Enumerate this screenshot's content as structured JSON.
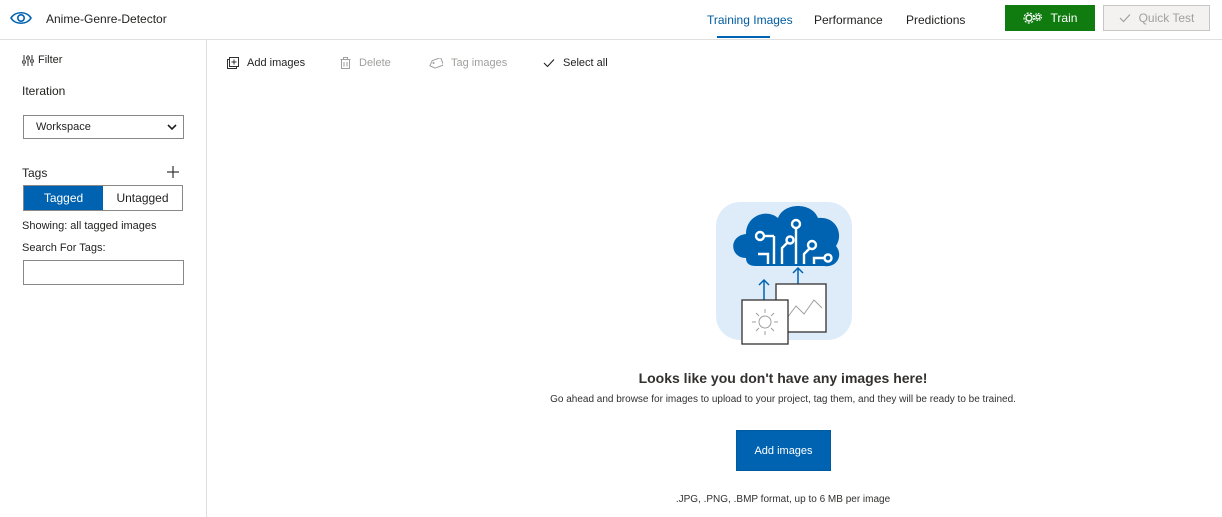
{
  "app": {
    "title": "Anime-Genre-Detector",
    "logo_icon": "eye-icon"
  },
  "nav": {
    "tabs": [
      {
        "label": "Training Images",
        "active": true
      },
      {
        "label": "Performance",
        "active": false
      },
      {
        "label": "Predictions",
        "active": false
      }
    ],
    "train_label": "Train",
    "quick_test_label": "Quick Test",
    "colors": {
      "train": "#107c10",
      "accent": "#0063b1"
    }
  },
  "sidebar": {
    "filter_label": "Filter",
    "iteration_label": "Iteration",
    "iteration_value": "Workspace",
    "tags_label": "Tags",
    "tagged_label": "Tagged",
    "untagged_label": "Untagged",
    "showing_text": "Showing: all tagged images",
    "search_label": "Search For Tags:",
    "search_value": ""
  },
  "toolbar": {
    "add_images": "Add images",
    "delete": "Delete",
    "tag_images": "Tag images",
    "select_all": "Select all"
  },
  "empty_state": {
    "title": "Looks like you don't have any images here!",
    "subtitle": "Go ahead and browse for images to upload to your project, tag them, and they will be ready to be trained.",
    "button_label": "Add images",
    "formats": ".JPG, .PNG, .BMP format, up to 6 MB per image"
  }
}
